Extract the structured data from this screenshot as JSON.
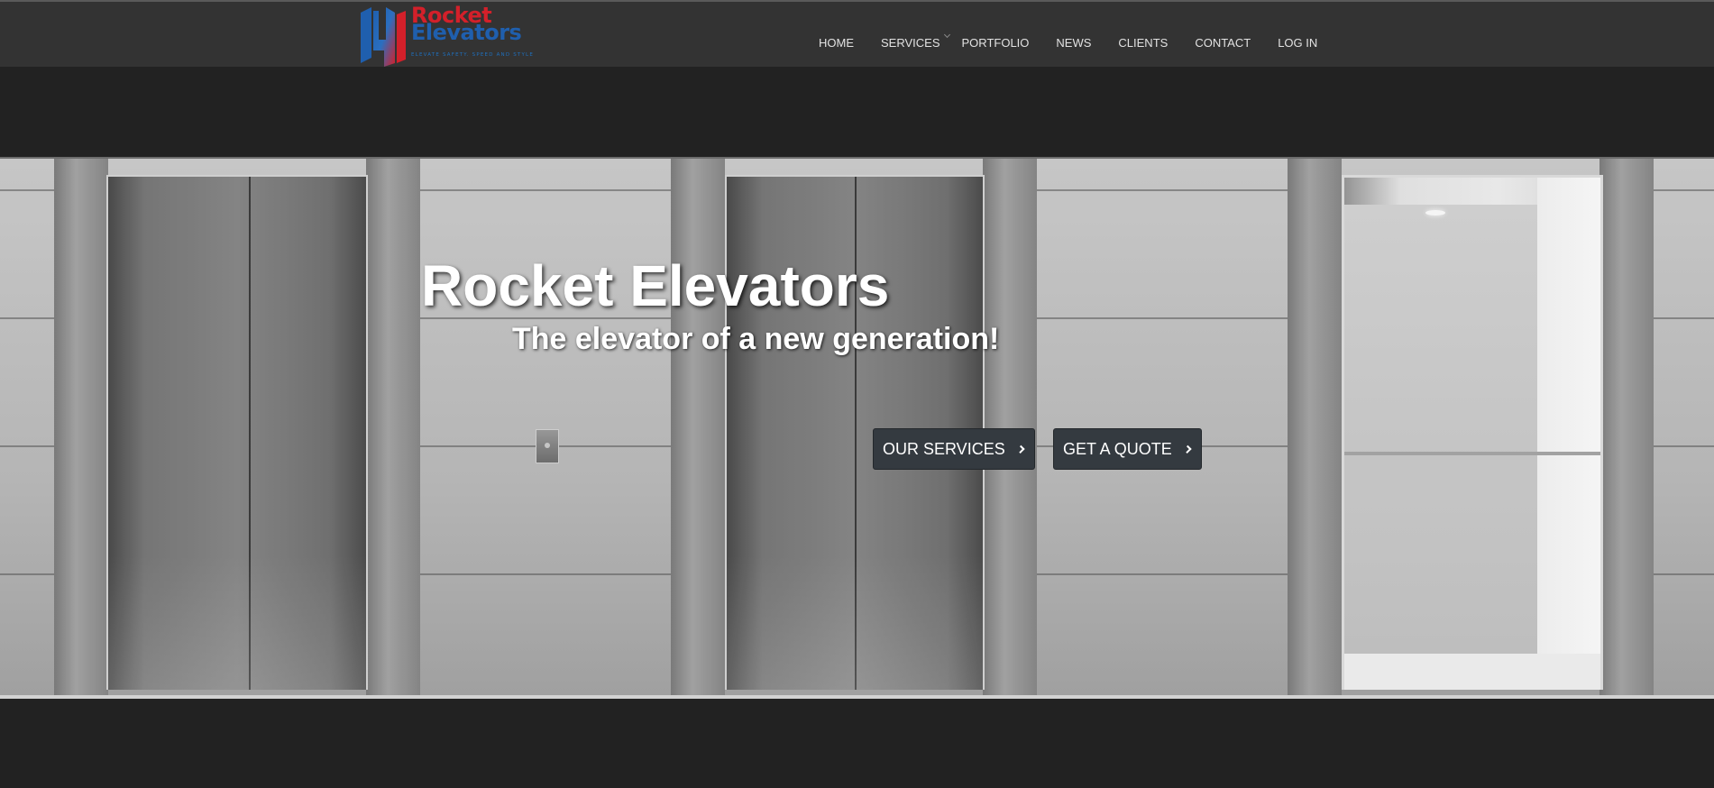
{
  "brand": {
    "name_line_1": "Rocket",
    "name_line_2": "Elevators",
    "tagline": "ELEVATE SAFETY. SPEED AND STYLE",
    "colors": {
      "red": "#d3202a",
      "blue": "#1f5fae"
    }
  },
  "nav": {
    "items": [
      {
        "label": "HOME"
      },
      {
        "label": "SERVICES",
        "has_dropdown": true
      },
      {
        "label": "PORTFOLIO"
      },
      {
        "label": "NEWS"
      },
      {
        "label": "CLIENTS"
      },
      {
        "label": "CONTACT"
      },
      {
        "label": "LOG IN"
      }
    ]
  },
  "hero": {
    "title": "Rocket Elevators",
    "subtitle": "The elevator of a new generation!",
    "buttons": [
      {
        "label": "OUR SERVICES",
        "icon": "chevron-right-icon"
      },
      {
        "label": "GET A QUOTE",
        "icon": "chevron-right-icon"
      }
    ]
  },
  "colors": {
    "page_background": "#222222",
    "header_background": "#333333",
    "button_background": "#343a40"
  }
}
